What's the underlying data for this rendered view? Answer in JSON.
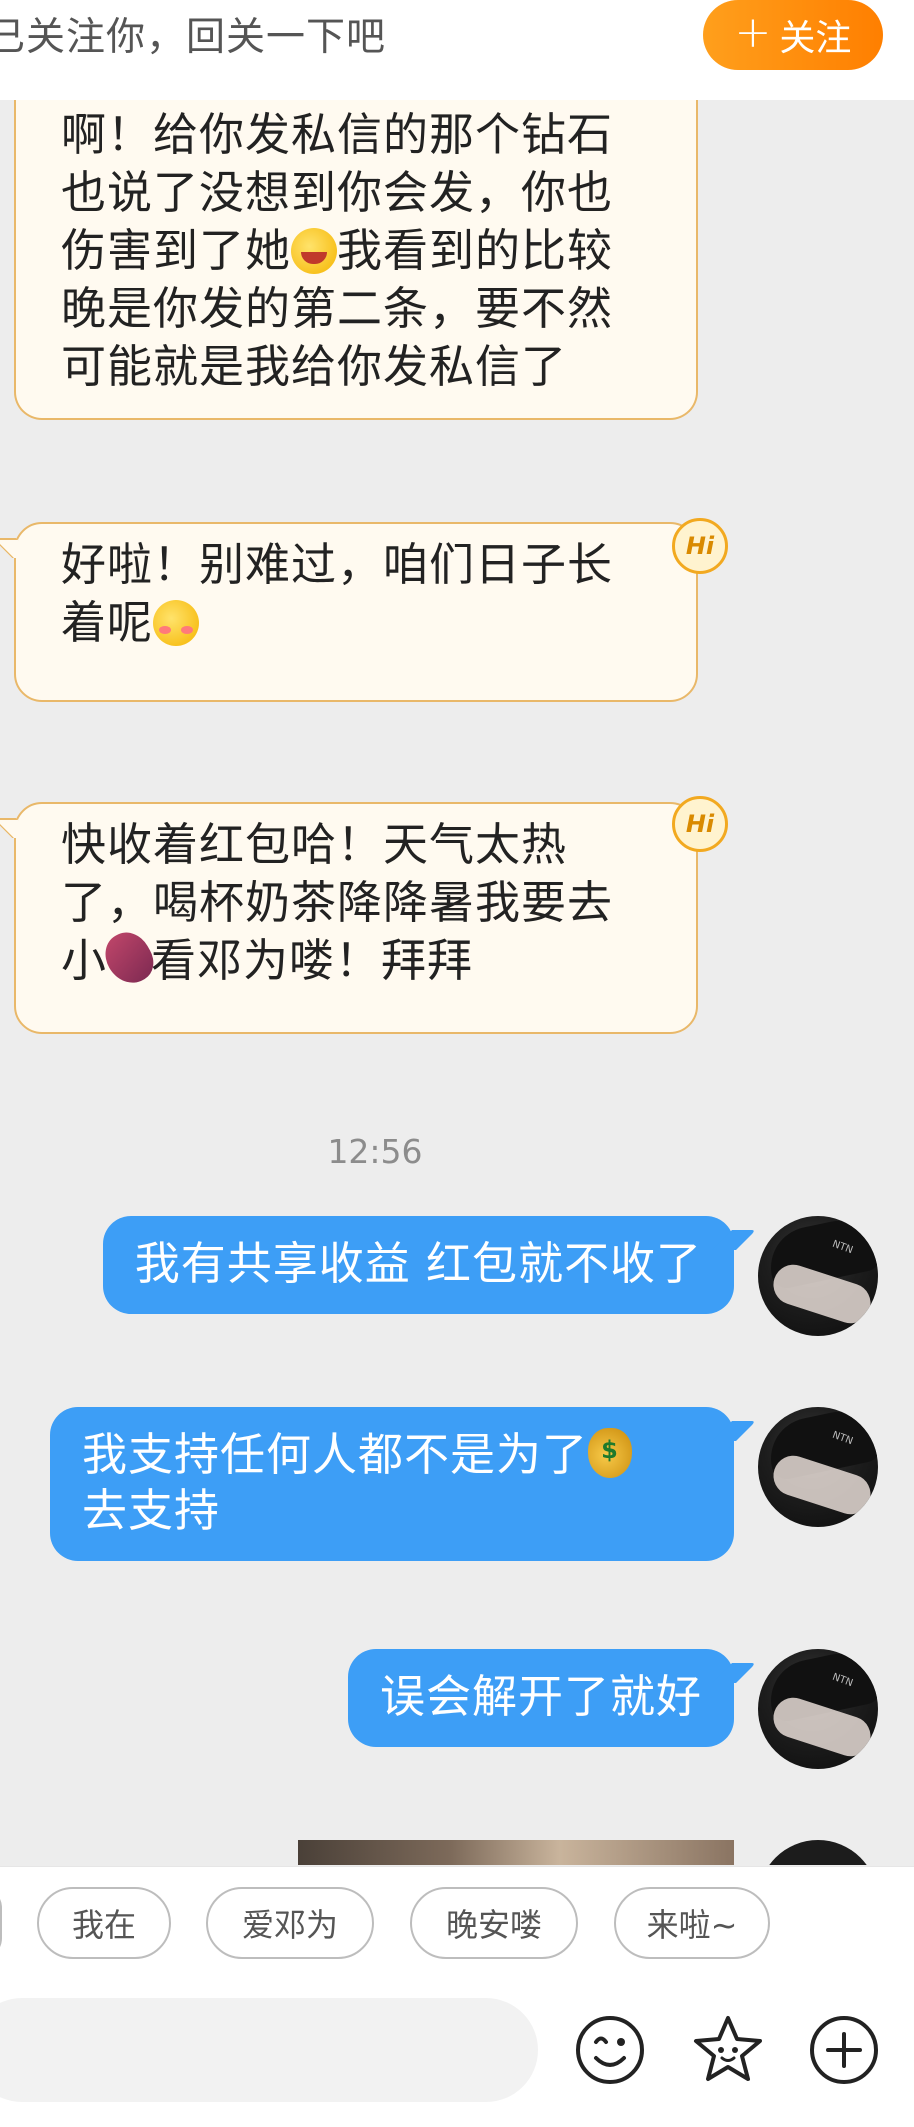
{
  "header": {
    "banner_text": "已关注你，回关一下吧",
    "follow_button": "关注"
  },
  "messages": {
    "m1_lines": [
      "啊！给你发私信的那个钻石",
      "也说了没想到你会发，你也",
      "伤害到了她",
      "我看到的比较",
      "晚是你发的第二条，要不然",
      "可能就是我给你发私信了"
    ],
    "m2_line1": "好啦！别难过，咱们日子长",
    "m2_line2": "着呢",
    "m3_line1": "快收着红包哈！天气太热",
    "m3_line2": "了，喝杯奶茶降降暑我要去",
    "m3_line3a": "小",
    "m3_line3b": "看邓为喽！拜拜",
    "hi_badge": "Hi",
    "timestamp": "12:56",
    "out1": "我有共享收益 红包就不收了",
    "out2_line1": "我支持任何人都不是为了",
    "out2_line2": "去支持",
    "out3": "误会解开了就好",
    "avatar_cap_text": "NTN"
  },
  "quick_replies": [
    "我在",
    "爱邓为",
    "晚安喽",
    "来啦~"
  ],
  "input": {
    "placeholder": ""
  },
  "icons": [
    "emoji-face-icon",
    "sticker-star-icon",
    "plus-circle-icon"
  ],
  "colors": {
    "accent_orange": "#ff8c0a",
    "incoming_bubble": "#fffaf0",
    "incoming_border": "#e9b869",
    "outgoing_bubble": "#3d9ef6",
    "background": "#ededed"
  }
}
